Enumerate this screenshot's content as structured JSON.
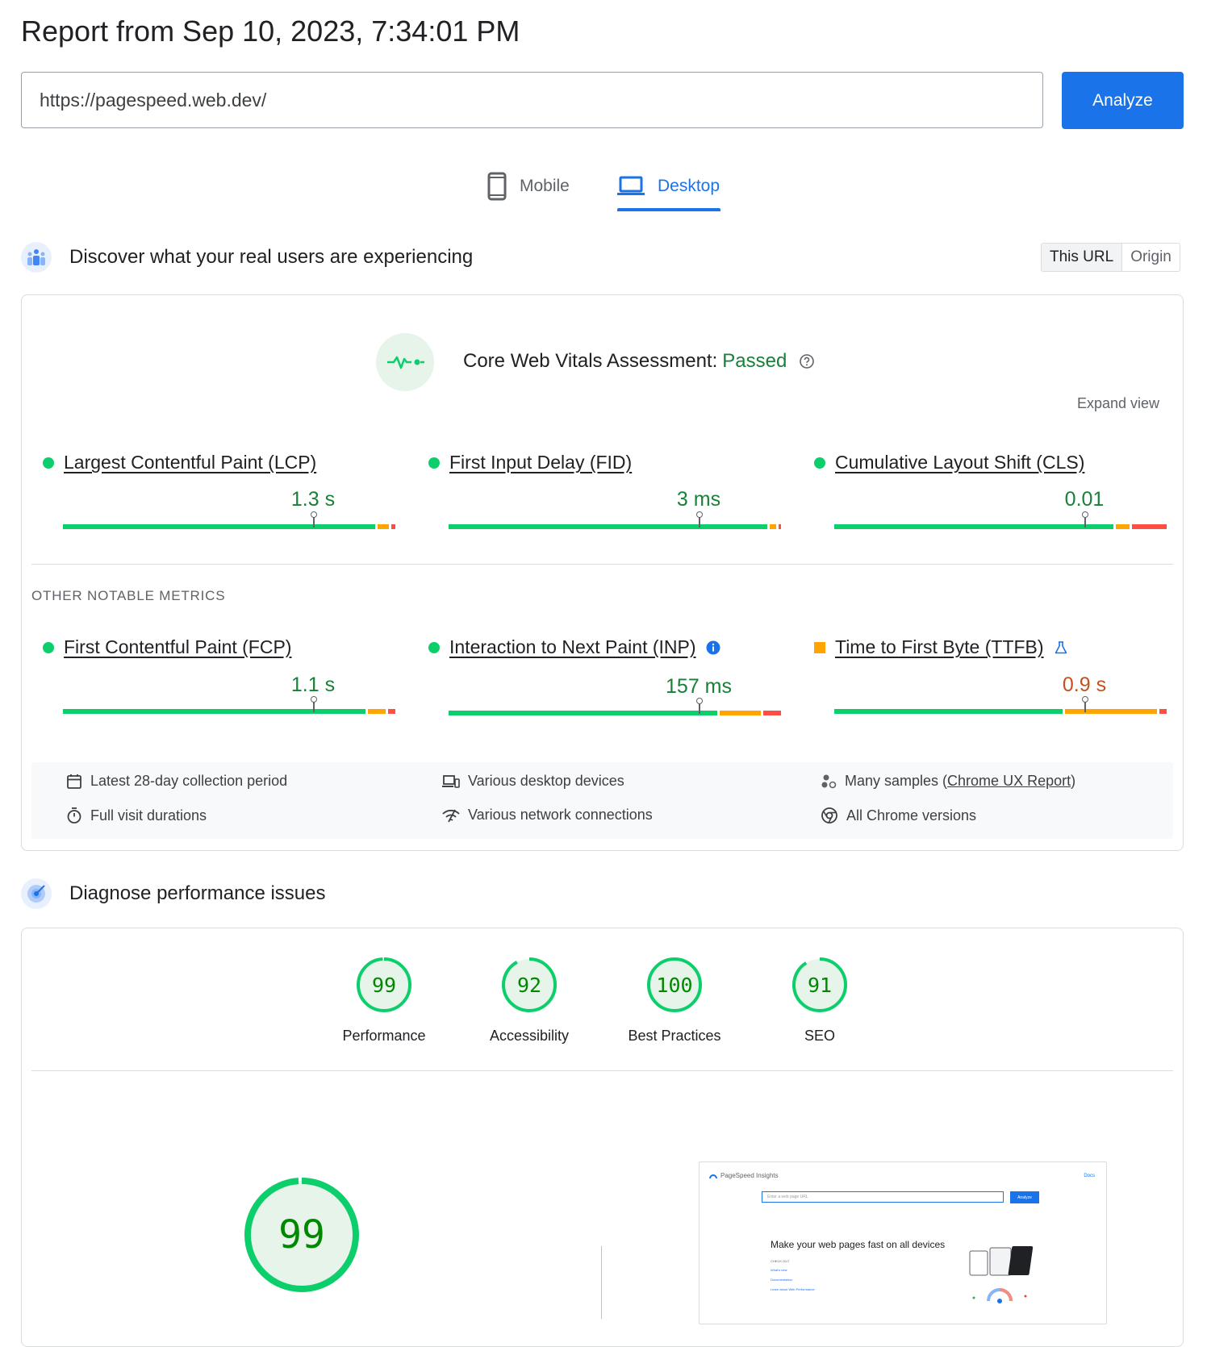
{
  "report": {
    "title": "Report from Sep 10, 2023, 7:34:01 PM"
  },
  "search": {
    "url": "https://pagespeed.web.dev/",
    "analyze_label": "Analyze"
  },
  "tabs": [
    {
      "label": "Mobile",
      "icon": "mobile-icon"
    },
    {
      "label": "Desktop",
      "icon": "laptop-icon",
      "selected": true
    }
  ],
  "field": {
    "title": "Discover what your real users are experiencing",
    "toggle": {
      "this_url": "This URL",
      "origin": "Origin",
      "selected": "This URL"
    },
    "assessment": {
      "label": "Core Web Vitals Assessment:",
      "status": "Passed"
    },
    "expand": "Expand view",
    "core_metrics": [
      {
        "label": "Largest Contentful Paint (LCP)",
        "value": "1.3 s",
        "status": "good",
        "marker": 0.75,
        "segments": [
          0.94,
          0.04,
          0.02
        ]
      },
      {
        "label": "First Input Delay (FID)",
        "value": "3 ms",
        "status": "good",
        "marker": 0.75,
        "segments": [
          0.96,
          0.025,
          0.015
        ]
      },
      {
        "label": "Cumulative Layout Shift (CLS)",
        "value": "0.01",
        "status": "good",
        "marker": 0.75,
        "segments": [
          0.84,
          0.05,
          0.11
        ]
      }
    ],
    "other_label": "OTHER NOTABLE METRICS",
    "other_metrics": [
      {
        "label": "First Contentful Paint (FCP)",
        "value": "1.1 s",
        "status": "good",
        "marker": 0.75,
        "segments": [
          0.91,
          0.06,
          0.03
        ]
      },
      {
        "label": "Interaction to Next Paint (INP)",
        "value": "157 ms",
        "status": "good",
        "marker": 0.75,
        "segments": [
          0.81,
          0.13,
          0.06
        ],
        "info_icon": "info-icon"
      },
      {
        "label": "Time to First Byte (TTFB)",
        "value": "0.9 s",
        "status": "average",
        "marker": 0.75,
        "segments": [
          0.69,
          0.28,
          0.03
        ],
        "lab_icon": "flask-icon"
      }
    ],
    "info": [
      {
        "icon": "calendar-icon",
        "text": "Latest 28-day collection period"
      },
      {
        "icon": "devices-icon",
        "text": "Various desktop devices"
      },
      {
        "icon": "samples-icon",
        "text_pre": "Many samples (",
        "link": "Chrome UX Report",
        "text_post": ")"
      },
      {
        "icon": "timer-icon",
        "text": "Full visit durations"
      },
      {
        "icon": "network-icon",
        "text": "Various network connections"
      },
      {
        "icon": "chrome-icon",
        "text": "All Chrome versions"
      }
    ]
  },
  "diagnose": {
    "title": "Diagnose performance issues",
    "scores": [
      {
        "label": "Performance",
        "score": "99"
      },
      {
        "label": "Accessibility",
        "score": "92"
      },
      {
        "label": "Best Practices",
        "score": "100"
      },
      {
        "label": "SEO",
        "score": "91"
      }
    ],
    "main_score": "99",
    "thumbnail": {
      "brand": "PageSpeed Insights",
      "docs": "Docs",
      "input_placeholder": "Enter a web page URL",
      "button": "Analyze",
      "headline": "Make your web pages fast on all devices",
      "checkout": "CHECK OUT",
      "links": [
        "What's new",
        "Documentation",
        "Learn about Web Performance"
      ]
    }
  },
  "colors": {
    "accent": "#1a73e8",
    "good": "#0cce6b",
    "good_text": "#188038",
    "average": "#ffa400",
    "average_text": "#c5501f",
    "poor": "#ff4e42",
    "score_text": "#008800"
  }
}
